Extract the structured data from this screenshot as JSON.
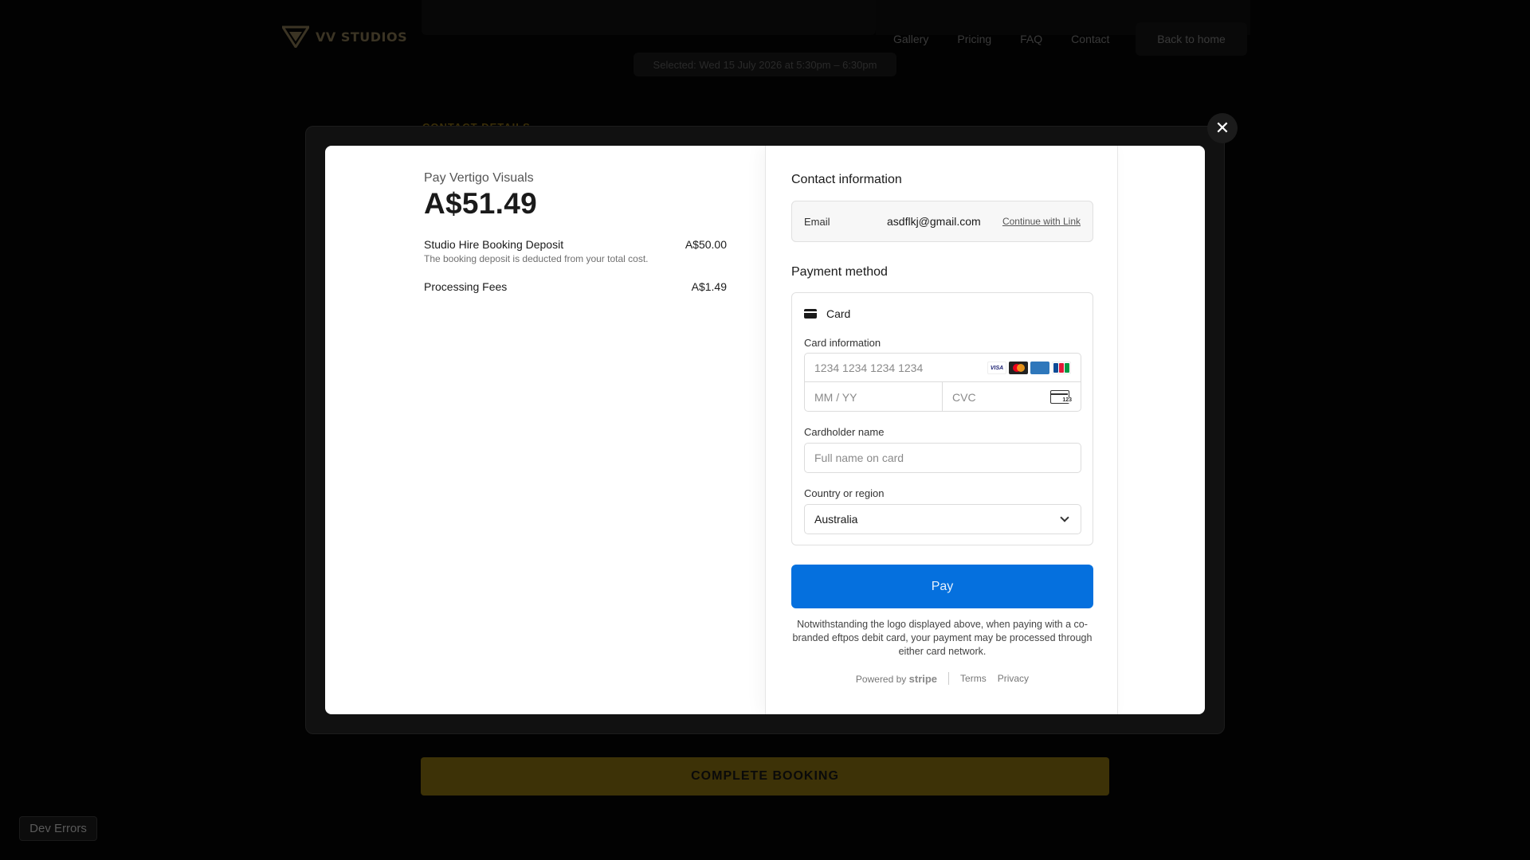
{
  "app": {
    "logo_text": "VV STUDIOS",
    "nav": [
      "Gallery",
      "Pricing",
      "FAQ",
      "Contact"
    ],
    "back_home": "Back to home",
    "selected_text": "Selected: Wed 15 July 2026 at 5:30pm – 6:30pm",
    "section_label": "CONTACT DETAILS",
    "complete_booking": "COMPLETE BOOKING",
    "dev_errors": "Dev Errors"
  },
  "modal": {
    "close_symbol": "✕"
  },
  "summary": {
    "merchant": "Pay Vertigo Visuals",
    "amount": "A$51.49",
    "items": [
      {
        "name": "Studio Hire Booking Deposit",
        "desc": "The booking deposit is deducted from your total cost.",
        "price": "A$50.00"
      },
      {
        "name": "Processing Fees",
        "price": "A$1.49"
      }
    ]
  },
  "form": {
    "contact_title": "Contact information",
    "email_label": "Email",
    "email_value": "asdflkj@gmail.com",
    "continue_link": "Continue with Link",
    "payment_title": "Payment method",
    "card_tab": "Card",
    "card_info_label": "Card information",
    "card_number_placeholder": "1234 1234 1234 1234",
    "expiry_placeholder": "MM / YY",
    "cvc_placeholder": "CVC",
    "cvc_icon_num": "123",
    "brands": [
      "VISA",
      "mastercard",
      "AMEX",
      "JCB"
    ],
    "cardholder_label": "Cardholder name",
    "cardholder_placeholder": "Full name on card",
    "country_label": "Country or region",
    "country_value": "Australia",
    "pay_button": "Pay",
    "disclaimer": "Notwithstanding the logo displayed above, when paying with a co-branded eftpos debit card, your payment may be processed through either card network.",
    "powered_by": "Powered by",
    "stripe": "stripe",
    "terms": "Terms",
    "privacy": "Privacy"
  },
  "colors": {
    "pay_button": "#0570de",
    "brand_gold": "#3d3207"
  }
}
